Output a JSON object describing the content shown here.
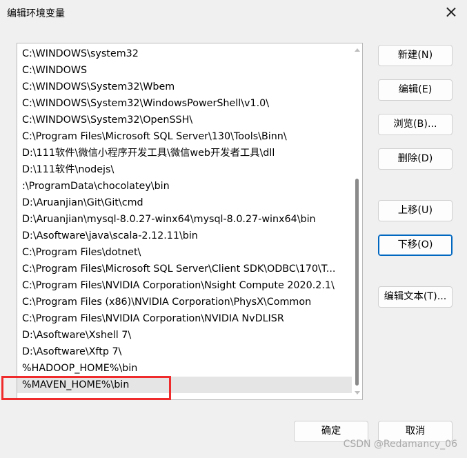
{
  "window": {
    "title": "编辑环境变量"
  },
  "paths": [
    "C:\\WINDOWS\\system32",
    "C:\\WINDOWS",
    "C:\\WINDOWS\\System32\\Wbem",
    "C:\\WINDOWS\\System32\\WindowsPowerShell\\v1.0\\",
    "C:\\WINDOWS\\System32\\OpenSSH\\",
    "C:\\Program Files\\Microsoft SQL Server\\130\\Tools\\Binn\\",
    "D:\\111软件\\微信小程序开发工具\\微信web开发者工具\\dll",
    "D:\\111软件\\nodejs\\",
    ":\\ProgramData\\chocolatey\\bin",
    "D:\\Aruanjian\\Git\\Git\\cmd",
    "D:\\Aruanjian\\mysql-8.0.27-winx64\\mysql-8.0.27-winx64\\bin",
    "D:\\Asoftware\\java\\scala-2.12.11\\bin",
    "C:\\Program Files\\dotnet\\",
    "C:\\Program Files\\Microsoft SQL Server\\Client SDK\\ODBC\\170\\T...",
    "C:\\Program Files\\NVIDIA Corporation\\Nsight Compute 2020.2.1\\",
    "C:\\Program Files (x86)\\NVIDIA Corporation\\PhysX\\Common",
    "C:\\Program Files\\NVIDIA Corporation\\NVIDIA NvDLISR",
    "D:\\Asoftware\\Xshell 7\\",
    "D:\\Asoftware\\Xftp 7\\",
    "%HADOOP_HOME%\\bin",
    "%MAVEN_HOME%\\bin"
  ],
  "selected_index": 20,
  "buttons": {
    "new": "新建(N)",
    "edit": "编辑(E)",
    "browse": "浏览(B)...",
    "delete": "删除(D)",
    "move_up": "上移(U)",
    "move_down": "下移(O)",
    "edit_text": "编辑文本(T)...",
    "ok": "确定",
    "cancel": "取消"
  },
  "watermark": "CSDN @Redamancy_06",
  "colors": {
    "highlight_box": "#ef2b2b",
    "selection": "#e5e5e5",
    "default_button_border": "#0067c0"
  }
}
